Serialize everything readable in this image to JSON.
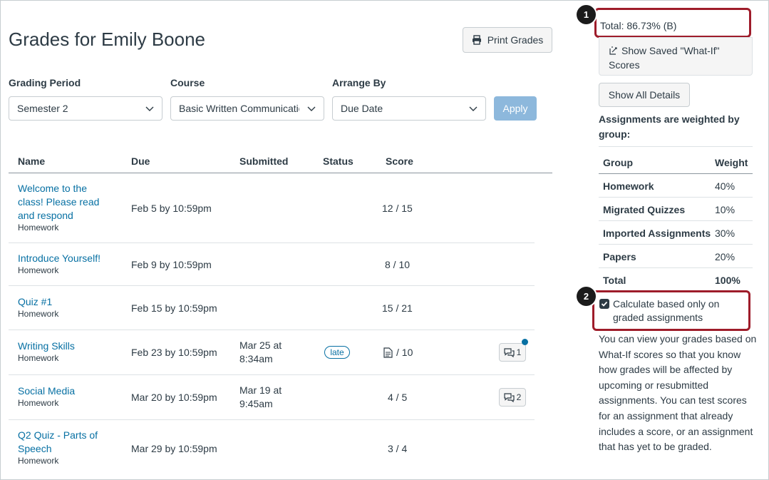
{
  "page": {
    "title": "Grades for Emily Boone"
  },
  "toolbar": {
    "print_label": "Print Grades",
    "apply_label": "Apply"
  },
  "filters": {
    "grading_period": {
      "label": "Grading Period",
      "value": "Semester 2"
    },
    "course": {
      "label": "Course",
      "value": "Basic Written Communication"
    },
    "arrange_by": {
      "label": "Arrange By",
      "value": "Due Date"
    }
  },
  "table": {
    "headers": {
      "name": "Name",
      "due": "Due",
      "submitted": "Submitted",
      "status": "Status",
      "score": "Score"
    },
    "rows": [
      {
        "name_lines": [
          "Welcome to the",
          "class! Please read",
          "and respond"
        ],
        "group": "Homework",
        "due": "Feb 5 by 10:59pm",
        "submitted": "",
        "status": "",
        "score": "12 / 15"
      },
      {
        "name_lines": [
          "Introduce Yourself!"
        ],
        "group": "Homework",
        "due": "Feb 9 by 10:59pm",
        "submitted": "",
        "status": "",
        "score": "8 / 10"
      },
      {
        "name_lines": [
          "Quiz #1"
        ],
        "group": "Homework",
        "due": "Feb 15 by 10:59pm",
        "submitted": "",
        "status": "",
        "score": "15 / 21"
      },
      {
        "name_lines": [
          "Writing Skills"
        ],
        "group": "Homework",
        "due": "Feb 23 by 10:59pm",
        "submitted_lines": [
          "Mar 25 at",
          "8:34am"
        ],
        "status": "late",
        "score": "/ 10",
        "comments": "1",
        "unread": true
      },
      {
        "name_lines": [
          "Social Media"
        ],
        "group": "Homework",
        "due": "Mar 20 by 10:59pm",
        "submitted_lines": [
          "Mar 19 at",
          "9:45am"
        ],
        "status": "",
        "score": "4 / 5",
        "comments": "2"
      },
      {
        "name_lines": [
          "Q2 Quiz - Parts of",
          "Speech"
        ],
        "group": "Homework",
        "due": "Mar 29 by 10:59pm",
        "submitted": "",
        "status": "",
        "score": "3 / 4"
      }
    ]
  },
  "sidebar": {
    "total": "Total: 86.73% (B)",
    "whatif_lines": [
      "Show Saved \"What-If\"",
      "Scores"
    ],
    "show_details": "Show All Details",
    "weighted_title": "Assignments are weighted by group:",
    "weights_headers": {
      "group": "Group",
      "weight": "Weight"
    },
    "weights": [
      {
        "group": "Homework",
        "weight": "40%"
      },
      {
        "group": "Migrated Quizzes",
        "weight": "10%"
      },
      {
        "group": "Imported Assignments",
        "weight": "30%"
      },
      {
        "group": "Papers",
        "weight": "20%"
      },
      {
        "group": "Total",
        "weight": "100%"
      }
    ],
    "calc_checkbox": {
      "lines": [
        "Calculate based only on",
        "graded assignments"
      ],
      "checked": true
    },
    "note": "You can view your grades based on What-If scores so that you know how grades will be affected by upcoming or resubmitted assignments. You can test scores for an assignment that already includes a score, or an assignment that has yet to be graded."
  },
  "callouts": [
    "1",
    "2"
  ],
  "colors": {
    "link": "#0770a3",
    "callout_border": "#9e1c2a",
    "apply_disabled": "#8db8dc"
  }
}
